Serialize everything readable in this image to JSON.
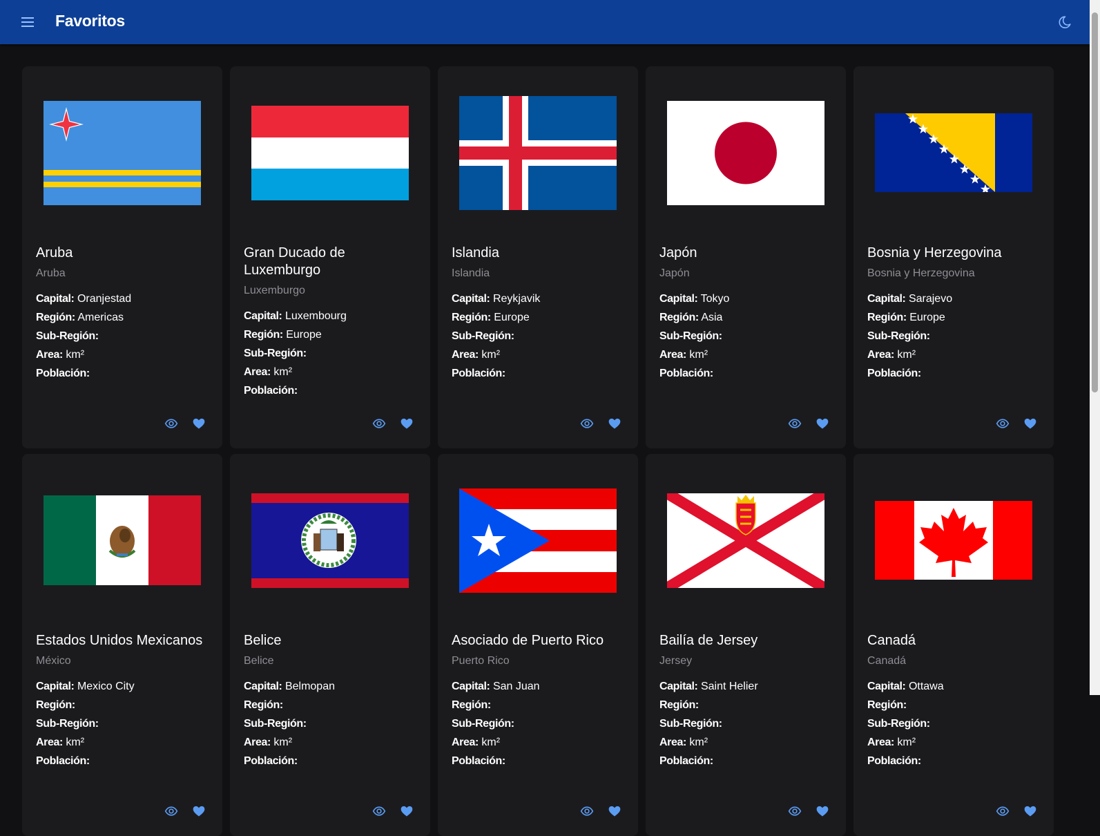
{
  "app": {
    "title": "Favoritos"
  },
  "labels": {
    "capital": "Capital:",
    "region": "Región:",
    "subregion": "Sub-Región:",
    "area": "Area:",
    "population": "Población:",
    "area_unit": "km²"
  },
  "icons": {
    "menu": "menu-icon",
    "theme": "moon-icon",
    "view": "eye-icon",
    "favorite": "heart-icon"
  },
  "colors": {
    "appbar": "#0d3f96",
    "accent": "#5b9cf3",
    "background": "#111113",
    "card": "#1b1b1e",
    "muted_text": "#8e8e93"
  },
  "countries": [
    {
      "name": "Aruba",
      "common": "Aruba",
      "capital": "Oranjestad",
      "region": "Americas",
      "flag": "aruba"
    },
    {
      "name": "Gran Ducado de Luxemburgo",
      "common": "Luxemburgo",
      "capital": "Luxembourg",
      "region": "Europe",
      "flag": "luxembourg"
    },
    {
      "name": "Islandia",
      "common": "Islandia",
      "capital": "Reykjavik",
      "region": "Europe",
      "flag": "iceland"
    },
    {
      "name": "Japón",
      "common": "Japón",
      "capital": "Tokyo",
      "region": "Asia",
      "flag": "japan"
    },
    {
      "name": "Bosnia y Herzegovina",
      "common": "Bosnia y Herzegovina",
      "capital": "Sarajevo",
      "region": "Europe",
      "flag": "bosnia"
    },
    {
      "name": "Estados Unidos Mexicanos",
      "common": "México",
      "capital": "Mexico City",
      "region": "",
      "flag": "mexico"
    },
    {
      "name": "Belice",
      "common": "Belice",
      "capital": "Belmopan",
      "region": "",
      "flag": "belize"
    },
    {
      "name": "Asociado de Puerto Rico",
      "common": "Puerto Rico",
      "capital": "San Juan",
      "region": "",
      "flag": "puertorico"
    },
    {
      "name": "Bailía de Jersey",
      "common": "Jersey",
      "capital": "Saint Helier",
      "region": "",
      "flag": "jersey"
    },
    {
      "name": "Canadá",
      "common": "Canadá",
      "capital": "Ottawa",
      "region": "",
      "flag": "canada"
    }
  ]
}
